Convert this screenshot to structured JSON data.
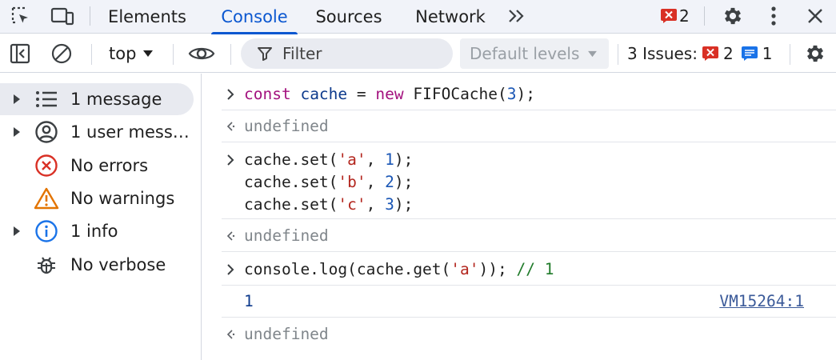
{
  "tabbar": {
    "tabs": [
      {
        "label": "Elements"
      },
      {
        "label": "Console",
        "active": true
      },
      {
        "label": "Sources"
      },
      {
        "label": "Network"
      }
    ],
    "error_count": "2"
  },
  "toolbar": {
    "context": "top",
    "filter_placeholder": "Filter",
    "levels": "Default levels",
    "issues_label": "3 Issues:",
    "issues_errors": "2",
    "issues_info": "1"
  },
  "sidebar": {
    "items": [
      {
        "label": "1 message",
        "icon": "list-icon",
        "expandable": true,
        "selected": true
      },
      {
        "label": "1 user messages",
        "icon": "user-icon",
        "expandable": true
      },
      {
        "label": "No errors",
        "icon": "error-icon",
        "expandable": false
      },
      {
        "label": "No warnings",
        "icon": "warning-icon",
        "expandable": false
      },
      {
        "label": "1 info",
        "icon": "info-icon",
        "expandable": true
      },
      {
        "label": "No verbose",
        "icon": "bug-icon",
        "expandable": false
      }
    ]
  },
  "console": {
    "e1": {
      "kw_const": "const",
      "var": "cache",
      "eq": " = ",
      "kw_new": "new",
      "cls": " FIFOCache(",
      "num": "3",
      "end": ");"
    },
    "r1": "undefined",
    "e2": {
      "l1": {
        "pre": "cache.set(",
        "str": "'a'",
        "mid": ", ",
        "num": "1",
        "end": ");"
      },
      "l2": {
        "pre": "cache.set(",
        "str": "'b'",
        "mid": ", ",
        "num": "2",
        "end": ");"
      },
      "l3": {
        "pre": "cache.set(",
        "str": "'c'",
        "mid": ", ",
        "num": "3",
        "end": ");"
      }
    },
    "r2": "undefined",
    "e3": {
      "pre": "console.log(cache.get(",
      "str": "'a'",
      "end": ")); ",
      "comment": "// 1"
    },
    "log_output": "1",
    "log_source": "VM15264:1",
    "r3": "undefined"
  },
  "colors": {
    "accent": "#0b57d0",
    "error_red": "#d93025",
    "info_blue": "#1a73e8",
    "warning_orange": "#e37400"
  }
}
